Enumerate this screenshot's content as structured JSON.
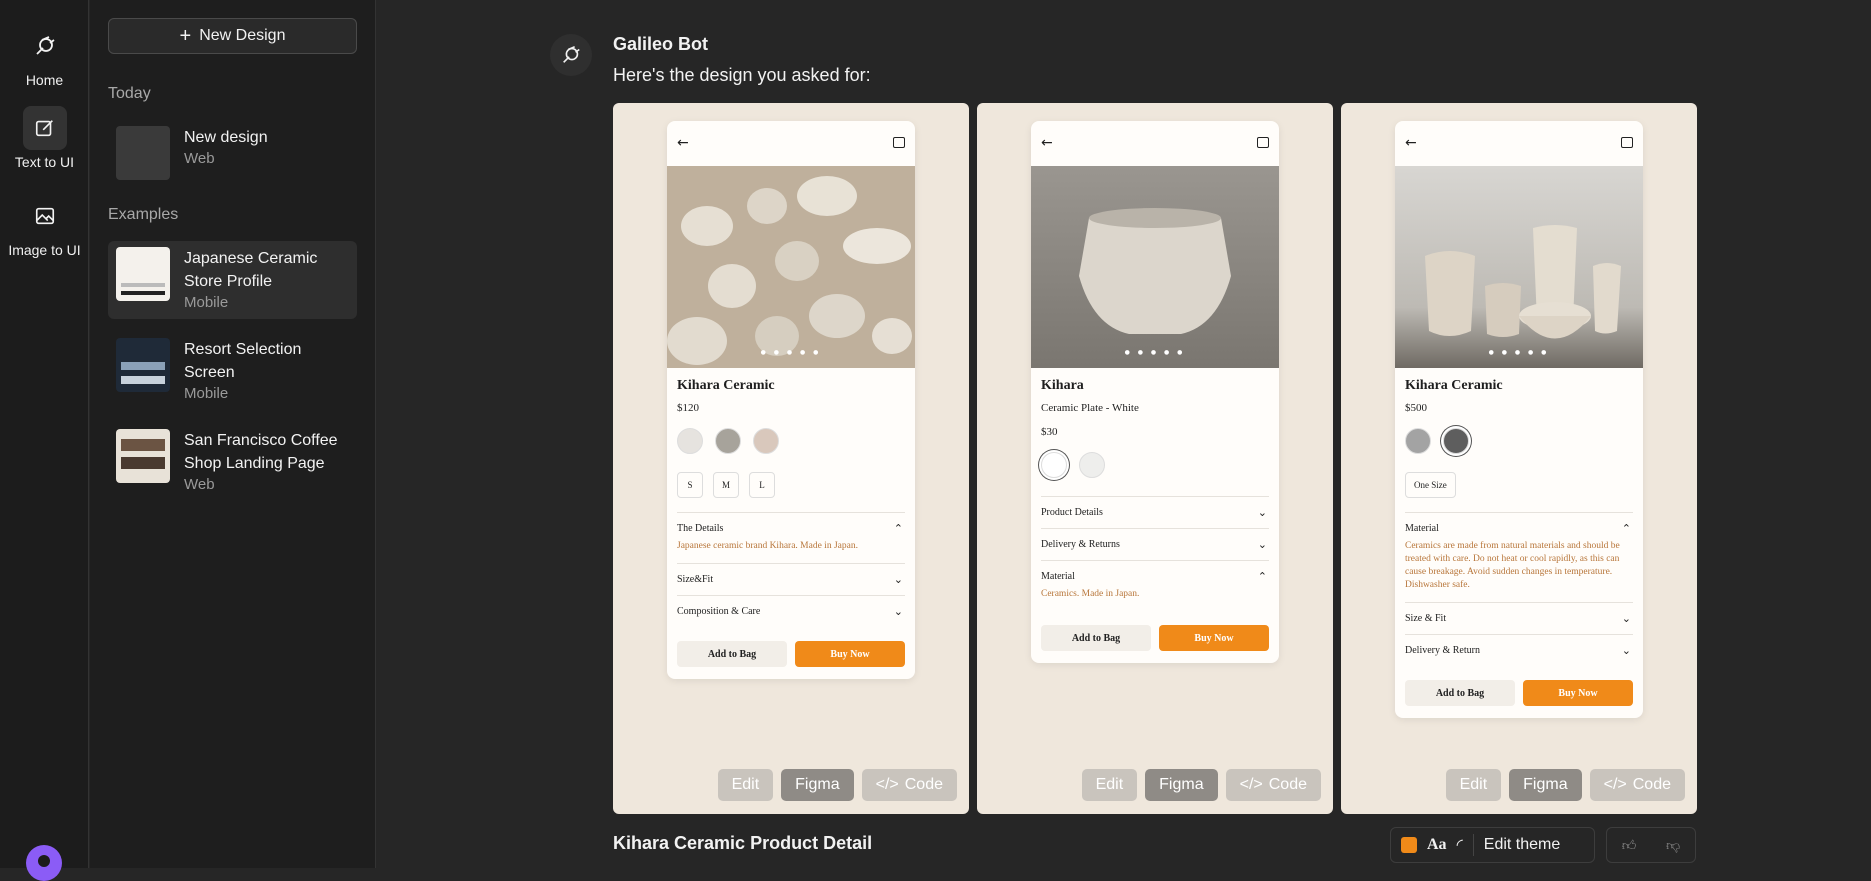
{
  "rail": {
    "home_label": "Home",
    "text_to_ui_label": "Text to UI",
    "image_to_ui_label": "Image to UI"
  },
  "sidebar": {
    "new_design_label": "New Design",
    "today_label": "Today",
    "today_items": [
      {
        "title": "New design",
        "subtitle": "Web"
      }
    ],
    "examples_label": "Examples",
    "examples": [
      {
        "title": "Japanese Ceramic Store Profile",
        "subtitle": "Mobile"
      },
      {
        "title": "Resort Selection Screen",
        "subtitle": "Mobile"
      },
      {
        "title": "San Francisco Coffee Shop Landing Page",
        "subtitle": "Web"
      }
    ]
  },
  "chat": {
    "bot_name": "Galileo Bot",
    "message": "Here's the design you asked for:",
    "design_title": "Kihara Ceramic Product Detail"
  },
  "screens": [
    {
      "title": "Kihara Ceramic",
      "price": "$120",
      "swatch_colors": [
        "#e6e3df",
        "#a7a39b",
        "#d9c8bc"
      ],
      "sizes": [
        "S",
        "M",
        "L"
      ],
      "accordions": [
        {
          "label": "The Details",
          "open": true,
          "desc": "Japanese ceramic brand Kihara. Made in Japan."
        },
        {
          "label": "Size&Fit",
          "open": false
        },
        {
          "label": "Composition & Care",
          "open": false
        }
      ],
      "add_to_bag": "Add to Bag",
      "buy_now": "Buy Now"
    },
    {
      "title": "Kihara",
      "subtitle": "Ceramic Plate - White",
      "price": "$30",
      "swatch_colors": [
        "#ffffff",
        "#eeeeec"
      ],
      "accordions": [
        {
          "label": "Product Details",
          "open": false
        },
        {
          "label": "Delivery & Returns",
          "open": false
        },
        {
          "label": "Material",
          "open": true,
          "desc": "Ceramics. Made in Japan."
        }
      ],
      "add_to_bag": "Add to Bag",
      "buy_now": "Buy Now"
    },
    {
      "title": "Kihara Ceramic",
      "price": "$500",
      "swatch_colors": [
        "#a3a3a3",
        "#5e5e5e"
      ],
      "sizes": [
        "One Size"
      ],
      "accordions": [
        {
          "label": "Material",
          "open": true,
          "desc": "Ceramics are made from natural materials and should be treated with care. Do not heat or cool rapidly, as this can cause breakage. Avoid sudden changes in temperature. Dishwasher safe."
        },
        {
          "label": "Size & Fit",
          "open": false
        },
        {
          "label": "Delivery & Return",
          "open": false
        }
      ],
      "add_to_bag": "Add to Bag",
      "buy_now": "Buy Now"
    }
  ],
  "card_actions": {
    "edit": "Edit",
    "figma": "Figma",
    "code": "Code"
  },
  "theme": {
    "font_label": "Aa",
    "edit_theme": "Edit theme",
    "accent_color": "#f08a19"
  }
}
